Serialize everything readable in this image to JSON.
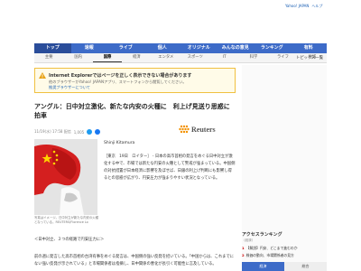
{
  "header": {
    "links": [
      "Yahoo! JAPAN",
      "ヘルプ"
    ]
  },
  "mainnav": {
    "tabs": [
      "トップ",
      "速報",
      "ライブ",
      "個人",
      "オリジナル",
      "みんなの意見",
      "ランキング",
      "有料"
    ]
  },
  "subnav": {
    "tabs": [
      "主要",
      "国内",
      "国際",
      "経済",
      "エンタメ",
      "スポーツ",
      "IT",
      "科学",
      "ライフ",
      "地域"
    ],
    "right": "トピックス一覧"
  },
  "warning": {
    "title": "Internet Explorerではページを正しく表示できない場合があります",
    "text": "他のブラウザーかYahoo! JAPANアプリ、スマートフォンから閲覧してください。",
    "link": "推奨ブラウザーについて"
  },
  "article": {
    "headline": "アングル：日中対立激化、新たな内安の火種に　利上げ見送り思惑に拍車",
    "meta": "11/19(水) 17:58 配信",
    "share_count": "1,005",
    "byline": "Shinji Kitamura",
    "provider": "Reuters",
    "caption": "写真はイメージ。日中対立が新たな内安の火種となっている。REUTERS/Florence Lo",
    "paragraph": "［東京　19日　ロイター］ - 日本の高市首相の発言をめぐる日中対立が激化する中で、市場では新たな円安の火種として警戒が強まっている。中国側の対抗措置が日本経済に影響を及ぼせば、日銀の利上げ判断にも影響し得るとの思惑が広がり、円安圧力が強まりやすい状況となっている。",
    "section": "＜日中対立、３つの経路で円安圧力に＞",
    "paragraph2": "前の週に発言した高市首相の台湾有事をめぐる発言は、中国側の強い反発を招いている。「中国からは、これまでにない強い反発が示されている」と市場関係者は指摘し、日中関係の悪化が長引く可能性に言及している。"
  },
  "sidebar": {
    "ranking_title": "アクセスランキング",
    "ranking_sub": "（経済）",
    "items": [
      {
        "num": "1",
        "text": "【解説】円安、どこまで進むのか"
      },
      {
        "num": "2",
        "text": "株価の動向、市場関係者の見方"
      }
    ],
    "tabs": [
      "経済",
      "総合"
    ]
  },
  "colors": {
    "nav": "#3d6bc8",
    "nav_active": "#2a4d9a",
    "warning_border": "#f0c040",
    "link": "#1a5fb4"
  }
}
